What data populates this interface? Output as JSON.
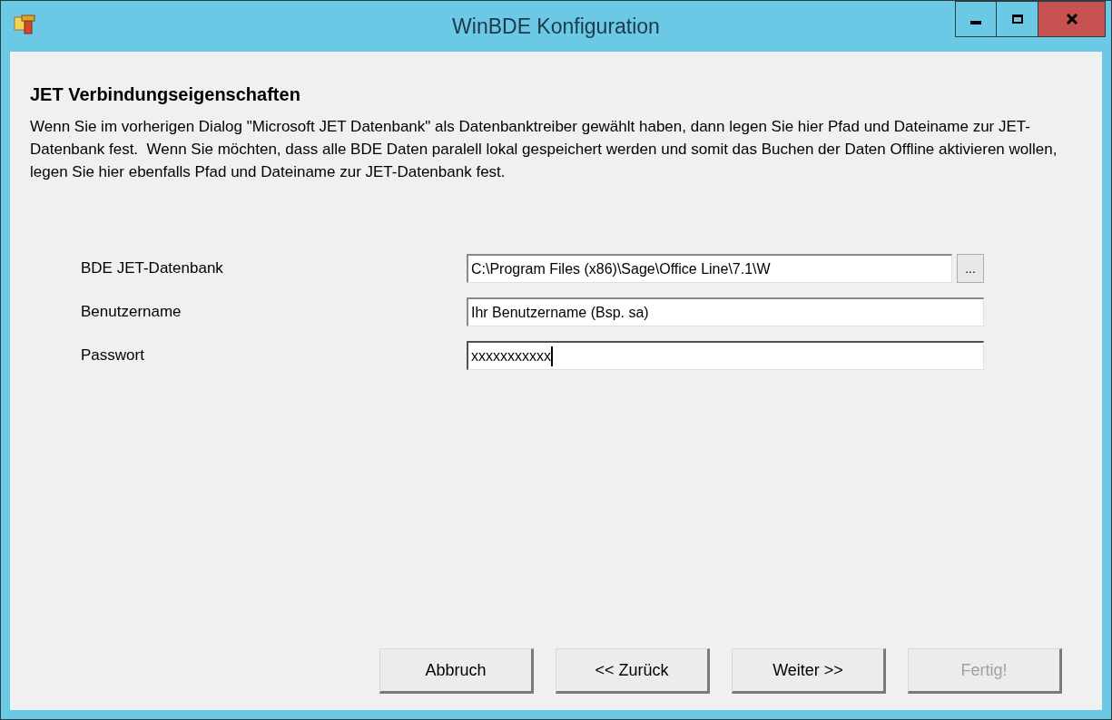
{
  "window": {
    "title": "WinBDE Konfiguration"
  },
  "heading": "JET Verbindungseigenschaften",
  "description": "Wenn Sie im vorherigen Dialog \"Microsoft JET Datenbank\" als Datenbanktreiber gewählt haben, dann legen Sie hier Pfad und Dateiname zur JET-Datenbank fest.  Wenn Sie möchten, dass alle BDE Daten paralell lokal gespeichert werden und somit das Buchen der Daten Offline aktivieren wollen, legen Sie hier ebenfalls Pfad und Dateiname zur JET-Datenbank fest.",
  "fields": [
    {
      "label": "BDE JET-Datenbank",
      "value": "C:\\Program Files (x86)\\Sage\\Office Line\\7.1\\W",
      "browse": "...",
      "focused": false
    },
    {
      "label": "Benutzername",
      "value": "Ihr Benutzername (Bsp. sa)",
      "focused": false
    },
    {
      "label": "Passwort",
      "value": "xxxxxxxxxxx",
      "focused": true
    }
  ],
  "buttons": [
    {
      "label": "Abbruch",
      "disabled": false
    },
    {
      "label": "<< Zurück",
      "disabled": false
    },
    {
      "label": "Weiter >>",
      "disabled": false
    },
    {
      "label": "Fertig!",
      "disabled": true
    }
  ]
}
